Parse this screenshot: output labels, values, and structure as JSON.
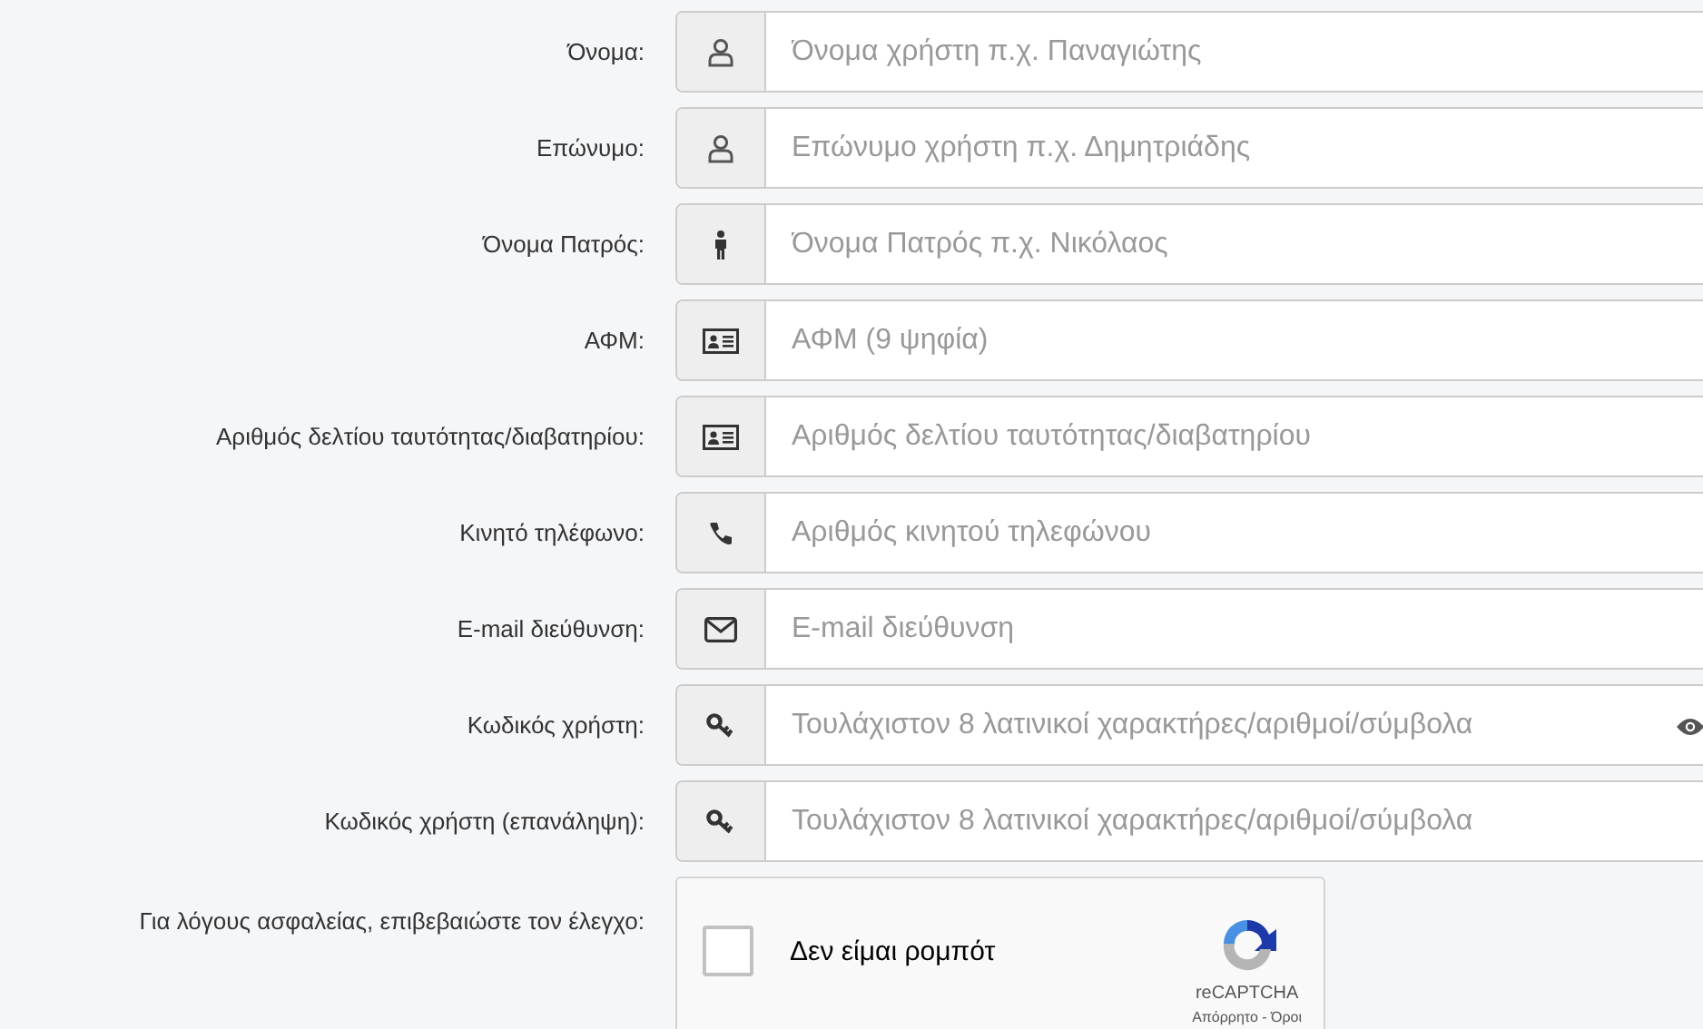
{
  "fields": [
    {
      "label": "Όνομα:",
      "kind": "user",
      "placeholder": "Όνομα χρήστη π.χ. Παναγιώτης"
    },
    {
      "label": "Επώνυμο:",
      "kind": "user",
      "placeholder": "Επώνυμο χρήστη π.χ. Δημητριάδης"
    },
    {
      "label": "Όνομα Πατρός:",
      "kind": "person",
      "placeholder": "Όνομα Πατρός π.χ. Νικόλαος"
    },
    {
      "label": "ΑΦΜ:",
      "kind": "idcard",
      "placeholder": "ΑΦΜ (9 ψηφία)"
    },
    {
      "label": "Αριθμός δελτίου ταυτότητας/διαβατηρίου:",
      "kind": "idcard",
      "placeholder": "Αριθμός δελτίου ταυτότητας/διαβατηρίου"
    },
    {
      "label": "Κινητό τηλέφωνο:",
      "kind": "phone",
      "placeholder": "Αριθμός κινητού τηλεφώνου"
    },
    {
      "label": "E-mail διεύθυνση:",
      "kind": "email",
      "placeholder": "E-mail διεύθυνση"
    },
    {
      "label": "Κωδικός χρήστη:",
      "kind": "password",
      "placeholder": "Τουλάχιστον 8 λατινικοί χαρακτήρες/αριθμοί/σύμβολα",
      "show_password_toggle": true
    },
    {
      "label": "Κωδικός χρήστη (επανάληψη):",
      "kind": "password",
      "placeholder": "Τουλάχιστον 8 λατινικοί χαρακτήρες/αριθμοί/σύμβολα"
    }
  ],
  "captcha": {
    "label": "Για λόγους ασφαλείας, επιβεβαιώστε τον έλεγχο:",
    "checked": false,
    "text": "Δεν είμαι ρομπότ",
    "brand": "reCAPTCHA",
    "links": "Απόρρητο - Όροι"
  }
}
